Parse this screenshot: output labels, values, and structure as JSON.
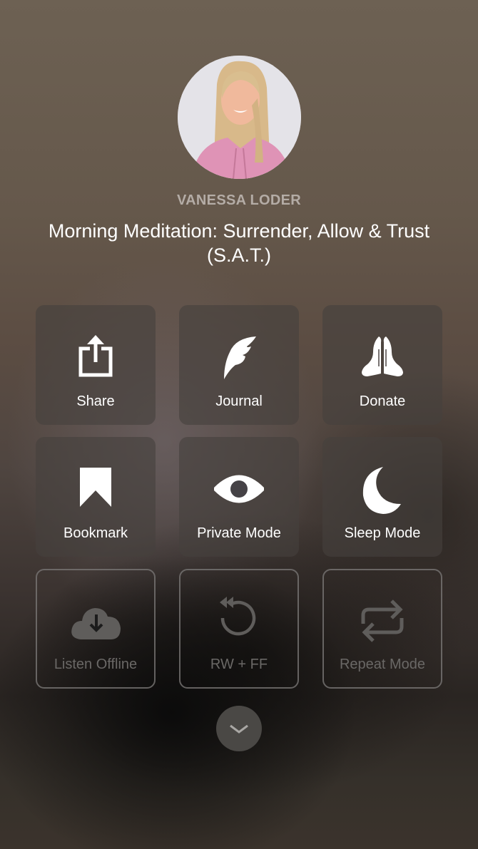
{
  "header": {
    "author": "VANESSA LODER",
    "title": "Morning Meditation: Surrender, Allow & Trust (S.A.T.)",
    "avatar": {
      "alt": "Vanessa Loder portrait",
      "icon": "avatar-photo"
    }
  },
  "actions": [
    {
      "label": "Share",
      "icon": "share-icon",
      "enabled": true
    },
    {
      "label": "Journal",
      "icon": "quill-icon",
      "enabled": true
    },
    {
      "label": "Donate",
      "icon": "praying-hands-icon",
      "enabled": true
    },
    {
      "label": "Bookmark",
      "icon": "bookmark-icon",
      "enabled": true
    },
    {
      "label": "Private Mode",
      "icon": "eye-icon",
      "enabled": true
    },
    {
      "label": "Sleep Mode",
      "icon": "moon-icon",
      "enabled": true
    },
    {
      "label": "Listen Offline",
      "icon": "cloud-download-icon",
      "enabled": false
    },
    {
      "label": "RW + FF",
      "icon": "rewind-icon",
      "enabled": false
    },
    {
      "label": "Repeat Mode",
      "icon": "repeat-icon",
      "enabled": false
    }
  ],
  "footer": {
    "collapse_icon": "chevron-down-icon"
  },
  "colors": {
    "active_icon": "#ffffff",
    "disabled_icon": "#6a6866",
    "author_text": "#b4aca6"
  }
}
